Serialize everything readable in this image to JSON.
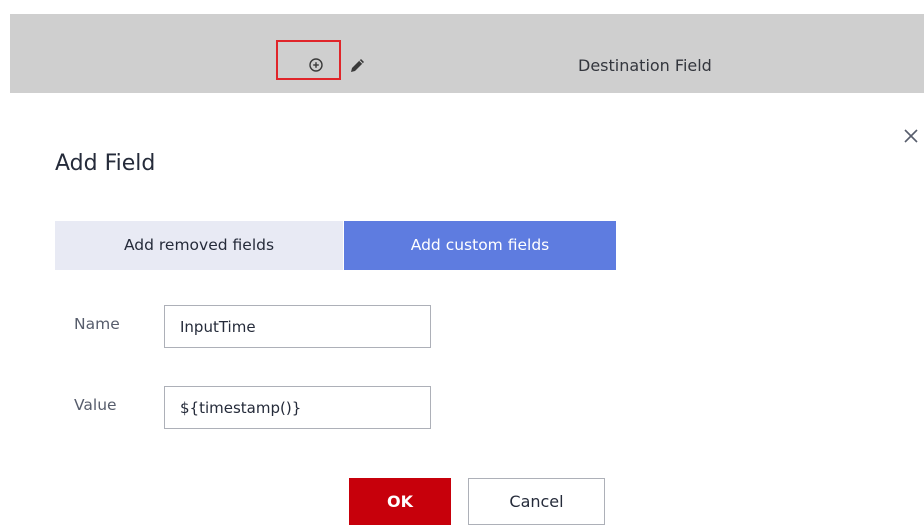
{
  "header": {
    "destination_field_label": "Destination Field",
    "add_icon": "add-circle-icon",
    "edit_icon": "pencil-icon",
    "highlight_color": "#e0252a"
  },
  "dialog": {
    "title": "Add Field",
    "close_icon": "close-icon",
    "tabs": [
      {
        "label": "Add removed fields",
        "active": false
      },
      {
        "label": "Add custom fields",
        "active": true
      }
    ],
    "fields": {
      "name": {
        "label": "Name",
        "value": "InputTime"
      },
      "value": {
        "label": "Value",
        "value": "${timestamp()}"
      }
    },
    "ok_label": "OK",
    "cancel_label": "Cancel"
  },
  "colors": {
    "primary_button": "#c7000b",
    "active_tab": "#5e7ce0",
    "inactive_tab": "#e8eaf4"
  }
}
